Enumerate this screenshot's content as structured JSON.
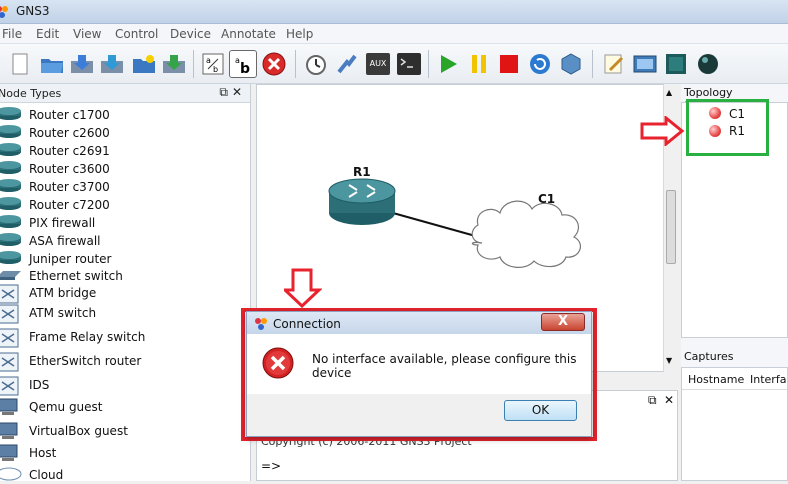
{
  "window": {
    "title": "GNS3"
  },
  "menu": [
    "File",
    "Edit",
    "View",
    "Control",
    "Device",
    "Annotate",
    "Help"
  ],
  "toolbar": {
    "aux_label": "AUX",
    "icons": [
      "new-file-icon",
      "open-folder-icon",
      "save-icon",
      "save-as-icon",
      "open-project-icon",
      "import-icon",
      "link-icon",
      "show-names-icon",
      "stop-linking-icon",
      "snapshot-clock-icon",
      "preferences-icon",
      "aux-console-icon",
      "console-icon",
      "start-icon",
      "pause-icon",
      "stop-icon",
      "reload-icon",
      "virtualbox-icon",
      "notes-icon",
      "screenshot-icon",
      "terminal-icon",
      "ball-icon"
    ]
  },
  "node_types": {
    "title": "Node Types",
    "items": [
      {
        "label": "Router c1700",
        "icon": "router-icon"
      },
      {
        "label": "Router c2600",
        "icon": "router-icon"
      },
      {
        "label": "Router c2691",
        "icon": "router-icon"
      },
      {
        "label": "Router c3600",
        "icon": "router-icon"
      },
      {
        "label": "Router c3700",
        "icon": "router-icon"
      },
      {
        "label": "Router c7200",
        "icon": "router-icon"
      },
      {
        "label": "PIX firewall",
        "icon": "firewall-icon"
      },
      {
        "label": "ASA firewall",
        "icon": "firewall-icon"
      },
      {
        "label": "Juniper router",
        "icon": "router-icon"
      },
      {
        "label": "Ethernet switch",
        "icon": "switch-icon"
      },
      {
        "label": "ATM bridge",
        "icon": "atm-bridge-icon"
      },
      {
        "label": "ATM switch",
        "icon": "atm-switch-icon"
      },
      {
        "label": "Frame Relay switch",
        "icon": "frame-relay-icon"
      },
      {
        "label": "EtherSwitch router",
        "icon": "etherswitch-icon"
      },
      {
        "label": "IDS",
        "icon": "ids-icon"
      },
      {
        "label": "Qemu guest",
        "icon": "computer-icon"
      },
      {
        "label": "VirtualBox guest",
        "icon": "computer-icon"
      },
      {
        "label": "Host",
        "icon": "computer-icon"
      },
      {
        "label": "Cloud",
        "icon": "cloud-icon"
      }
    ]
  },
  "canvas": {
    "router_label": "R1",
    "cloud_label": "C1"
  },
  "console": {
    "partial_text": "Copyright (c) 2006-2011 GNS3 Project",
    "prompt": "=>"
  },
  "topology_summary": {
    "title": "Topology Summary",
    "items": [
      "C1",
      "R1"
    ]
  },
  "captures": {
    "title": "Captures",
    "columns": [
      "Hostname",
      "Interfa"
    ]
  },
  "dialog": {
    "title": "Connection",
    "close_label": "X",
    "message": "No interface available, please configure this device",
    "ok_label": "OK"
  },
  "colors": {
    "annotation_red": "#e8232d",
    "annotation_green": "#28b040",
    "router_teal": "#2d6f77"
  }
}
